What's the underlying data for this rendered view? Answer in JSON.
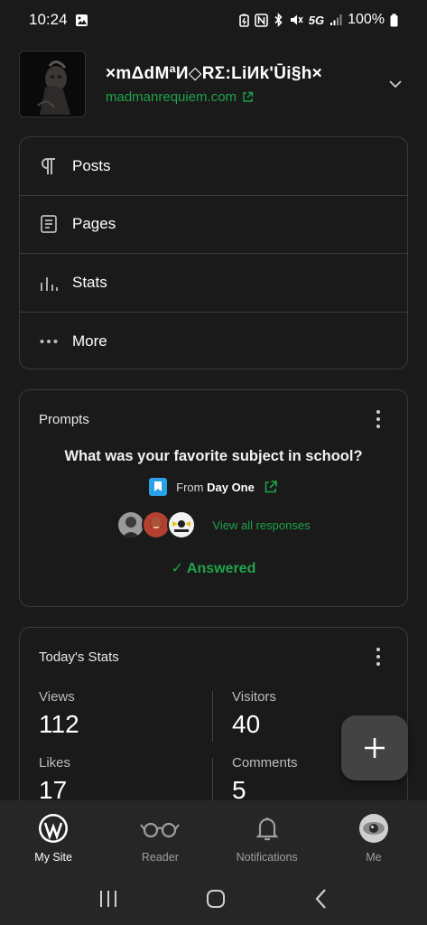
{
  "status": {
    "time": "10:24",
    "battery": "100%",
    "network": "5G"
  },
  "site": {
    "title": "×mΔdMªИ◇RΣ:LiИk'Ūi§h×",
    "url": "madmanrequiem.com"
  },
  "menu": {
    "items": [
      {
        "label": "Posts",
        "icon": "pilcrow-icon"
      },
      {
        "label": "Pages",
        "icon": "page-icon"
      },
      {
        "label": "Stats",
        "icon": "bar-chart-icon"
      },
      {
        "label": "More",
        "icon": "more-horizontal-icon"
      }
    ]
  },
  "prompts": {
    "title": "Prompts",
    "question": "What was your favorite subject in school?",
    "from_prefix": "From",
    "from_source": "Day One",
    "view_all": "View all responses",
    "answered": "✓ Answered"
  },
  "stats": {
    "title": "Today's Stats",
    "views_label": "Views",
    "views_value": "112",
    "visitors_label": "Visitors",
    "visitors_value": "40",
    "likes_label": "Likes",
    "likes_value": "17",
    "comments_label": "Comments",
    "comments_value": "5"
  },
  "bottom_nav": {
    "tabs": [
      {
        "label": "My Site",
        "icon": "wordpress-icon",
        "active": true
      },
      {
        "label": "Reader",
        "icon": "glasses-icon",
        "active": false
      },
      {
        "label": "Notifications",
        "icon": "bell-icon",
        "active": false
      },
      {
        "label": "Me",
        "icon": "avatar-icon",
        "active": false
      }
    ]
  },
  "colors": {
    "accent_green": "#1fa34a",
    "background": "#1a1a1a",
    "card_border": "#3a3a3a",
    "nav_background": "#262626"
  }
}
